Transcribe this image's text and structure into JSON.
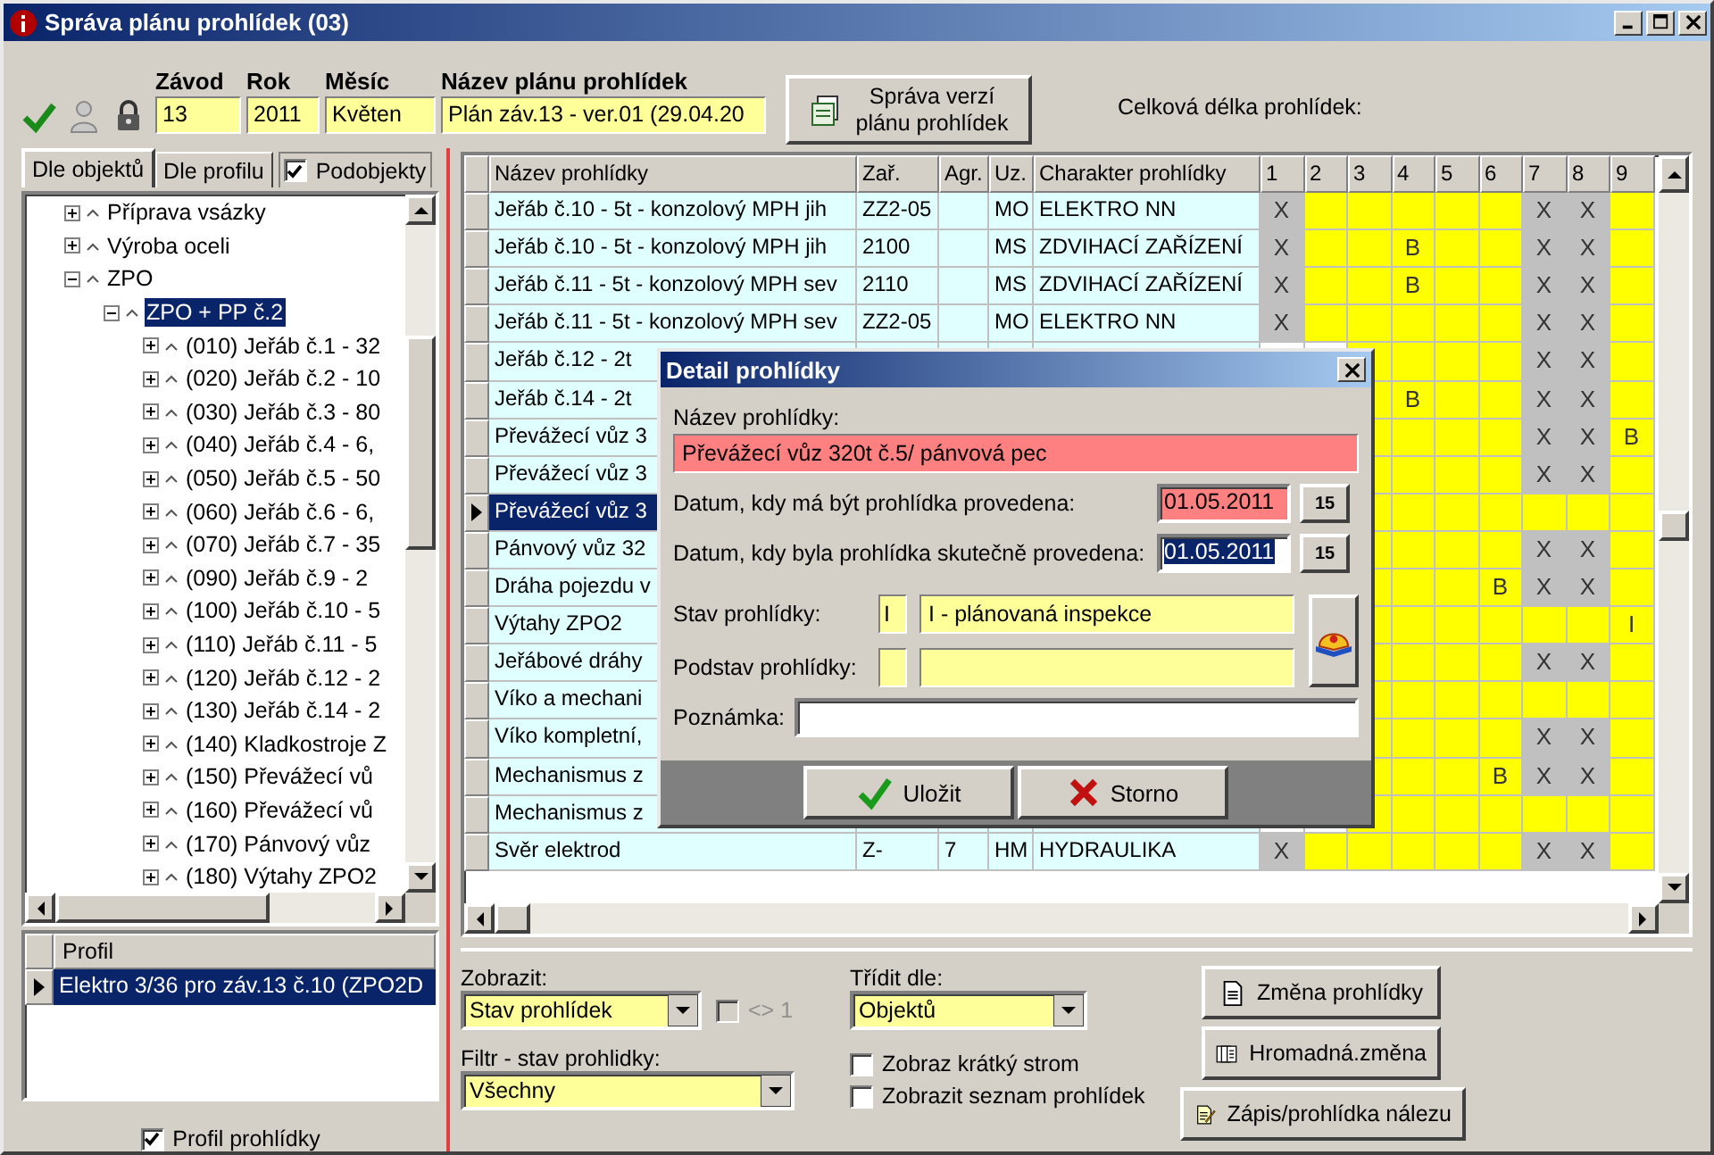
{
  "window": {
    "title": "Správa plánu prohlídek (03)"
  },
  "toolbar": {
    "fields": [
      {
        "label": "Závod",
        "value": "13"
      },
      {
        "label": "Rok",
        "value": "2011"
      },
      {
        "label": "Měsíc",
        "value": "Květen"
      },
      {
        "label": "Název plánu prohlídek",
        "value": "Plán záv.13 - ver.01 (29.04.20"
      }
    ],
    "version_button": "Správa verzí plánu prohlídek",
    "total_label": "Celková délka prohlídek:"
  },
  "left": {
    "tabs": [
      {
        "label": "Dle objektů",
        "selected": true
      },
      {
        "label": "Dle profilu",
        "selected": false
      }
    ],
    "subobjects": {
      "label": "Podobjekty",
      "checked": true
    },
    "tree": [
      {
        "label": "Příprava vsázky",
        "expanded": false,
        "selected": false
      },
      {
        "label": "Výroba oceli",
        "expanded": false,
        "selected": false
      },
      {
        "label": "ZPO",
        "expanded": true,
        "selected": false,
        "children": [
          {
            "label": "ZPO + PP č.2",
            "expanded": true,
            "selected": true,
            "children": [
              {
                "label": "(010) Jeřáb č.1 - 32",
                "expanded": false,
                "selected": false
              },
              {
                "label": "(020) Jeřáb č.2 - 10",
                "expanded": false,
                "selected": false
              },
              {
                "label": "(030) Jeřáb č.3 - 80",
                "expanded": false,
                "selected": false
              },
              {
                "label": "(040) Jeřáb č.4 - 6,",
                "expanded": false,
                "selected": false
              },
              {
                "label": "(050) Jeřáb č.5 - 50",
                "expanded": false,
                "selected": false
              },
              {
                "label": "(060) Jeřáb č.6 - 6,",
                "expanded": false,
                "selected": false
              },
              {
                "label": "(070) Jeřáb č.7 - 35",
                "expanded": false,
                "selected": false
              },
              {
                "label": "(090) Jeřáb č.9 - 2",
                "expanded": false,
                "selected": false
              },
              {
                "label": "(100) Jeřáb č.10 - 5",
                "expanded": false,
                "selected": false
              },
              {
                "label": "(110) Jeřáb č.11 - 5",
                "expanded": false,
                "selected": false
              },
              {
                "label": "(120) Jeřáb č.12 - 2",
                "expanded": false,
                "selected": false
              },
              {
                "label": "(130) Jeřáb č.14 - 2",
                "expanded": false,
                "selected": false
              },
              {
                "label": "(140) Kladkostroje Z",
                "expanded": false,
                "selected": false
              },
              {
                "label": "(150) Převážecí vů",
                "expanded": false,
                "selected": false
              },
              {
                "label": "(160) Převážecí vů",
                "expanded": false,
                "selected": false
              },
              {
                "label": "(170) Pánvový vůz",
                "expanded": false,
                "selected": false
              },
              {
                "label": "(180) Výtahy ZPO2",
                "expanded": false,
                "selected": false
              }
            ]
          }
        ]
      }
    ],
    "profile": {
      "column": "Profil",
      "rows": [
        {
          "text": "Elektro 3/36 pro záv.13 č.10 (ZPO2D",
          "selected": true
        }
      ]
    },
    "profile_check": {
      "label": "Profil prohlídky",
      "checked": true
    }
  },
  "grid": {
    "columns": [
      "Název prohlídky",
      "Zař.",
      "Agr.",
      "Uz.",
      "Charakter prohlídky",
      "1",
      "2",
      "3",
      "4",
      "5",
      "6",
      "7",
      "8",
      "9"
    ],
    "rows": [
      {
        "name": "Jeřáb č.10 - 5t - konzolový MPH jih",
        "device": "ZZ2-05",
        "uz": "MO",
        "character": "ELEKTRO NN",
        "selected": false,
        "cells": [
          {
            "kind": "blocked",
            "text": "X"
          },
          {
            "kind": "open"
          },
          {
            "kind": "open"
          },
          {
            "kind": "open"
          },
          {
            "kind": "open"
          },
          {
            "kind": "open"
          },
          {
            "kind": "blocked",
            "text": "X"
          },
          {
            "kind": "blocked",
            "text": "X"
          },
          {
            "kind": "open"
          }
        ]
      },
      {
        "name": "Jeřáb č.10 - 5t - konzolový MPH jih",
        "device": "2100",
        "uz": "MS",
        "character": "ZDVIHACÍ ZAŘÍZENÍ",
        "selected": false,
        "cells": [
          {
            "kind": "blocked",
            "text": "X"
          },
          {
            "kind": "open"
          },
          {
            "kind": "open"
          },
          {
            "kind": "open",
            "text": "B"
          },
          {
            "kind": "open"
          },
          {
            "kind": "open"
          },
          {
            "kind": "blocked",
            "text": "X"
          },
          {
            "kind": "blocked",
            "text": "X"
          },
          {
            "kind": "open"
          }
        ]
      },
      {
        "name": "Jeřáb č.11 - 5t - konzolový MPH sev",
        "device": "2110",
        "uz": "MS",
        "character": "ZDVIHACÍ ZAŘÍZENÍ",
        "selected": false,
        "cells": [
          {
            "kind": "blocked",
            "text": "X"
          },
          {
            "kind": "open"
          },
          {
            "kind": "open"
          },
          {
            "kind": "open",
            "text": "B"
          },
          {
            "kind": "open"
          },
          {
            "kind": "open"
          },
          {
            "kind": "blocked",
            "text": "X"
          },
          {
            "kind": "blocked",
            "text": "X"
          },
          {
            "kind": "open"
          }
        ]
      },
      {
        "name": "Jeřáb č.11 - 5t - konzolový MPH sev",
        "device": "ZZ2-05",
        "uz": "MO",
        "character": "ELEKTRO NN",
        "selected": false,
        "cells": [
          {
            "kind": "blocked",
            "text": "X"
          },
          {
            "kind": "open"
          },
          {
            "kind": "open"
          },
          {
            "kind": "open"
          },
          {
            "kind": "open"
          },
          {
            "kind": "open"
          },
          {
            "kind": "blocked",
            "text": "X"
          },
          {
            "kind": "blocked",
            "text": "X"
          },
          {
            "kind": "open"
          }
        ]
      },
      {
        "name": "Jeřáb č.12 - 2t",
        "selected": false,
        "cells": [
          {},
          {},
          {
            "kind": "open"
          },
          {
            "kind": "open"
          },
          {
            "kind": "open"
          },
          {
            "kind": "open"
          },
          {
            "kind": "blocked",
            "text": "X"
          },
          {
            "kind": "blocked",
            "text": "X"
          },
          {
            "kind": "open"
          }
        ]
      },
      {
        "name": "Jeřáb č.14 - 2t",
        "selected": false,
        "cells": [
          {},
          {},
          {
            "kind": "open"
          },
          {
            "kind": "open",
            "text": "B"
          },
          {
            "kind": "open"
          },
          {
            "kind": "open"
          },
          {
            "kind": "blocked",
            "text": "X"
          },
          {
            "kind": "blocked",
            "text": "X"
          },
          {
            "kind": "open"
          }
        ]
      },
      {
        "name": "Převážecí vůz 3",
        "selected": false,
        "cells": [
          {},
          {},
          {
            "kind": "open"
          },
          {
            "kind": "open"
          },
          {
            "kind": "open"
          },
          {
            "kind": "open"
          },
          {
            "kind": "blocked",
            "text": "X"
          },
          {
            "kind": "blocked",
            "text": "X"
          },
          {
            "kind": "open",
            "text": "B"
          }
        ]
      },
      {
        "name": "Převážecí vůz 3",
        "selected": false,
        "cells": [
          {},
          {},
          {
            "kind": "open"
          },
          {
            "kind": "open"
          },
          {
            "kind": "open"
          },
          {
            "kind": "open"
          },
          {
            "kind": "blocked",
            "text": "X"
          },
          {
            "kind": "blocked",
            "text": "X"
          },
          {
            "kind": "open"
          }
        ]
      },
      {
        "name": "Převážecí vůz 3",
        "selected": true,
        "cells": [
          {},
          {},
          {
            "kind": "open"
          },
          {
            "kind": "open"
          },
          {
            "kind": "open"
          },
          {
            "kind": "open"
          },
          {
            "kind": "open"
          },
          {
            "kind": "open"
          },
          {
            "kind": "open"
          }
        ]
      },
      {
        "name": "Pánvový vůz 32",
        "selected": false,
        "cells": [
          {},
          {},
          {
            "kind": "open"
          },
          {
            "kind": "open"
          },
          {
            "kind": "open"
          },
          {
            "kind": "open"
          },
          {
            "kind": "blocked",
            "text": "X"
          },
          {
            "kind": "blocked",
            "text": "X"
          },
          {
            "kind": "open"
          }
        ]
      },
      {
        "name": "Dráha pojezdu v",
        "selected": false,
        "cells": [
          {},
          {},
          {
            "kind": "open"
          },
          {
            "kind": "open"
          },
          {
            "kind": "open"
          },
          {
            "kind": "open",
            "text": "B"
          },
          {
            "kind": "blocked",
            "text": "X"
          },
          {
            "kind": "blocked",
            "text": "X"
          },
          {
            "kind": "open"
          }
        ]
      },
      {
        "name": "Výtahy ZPO2",
        "selected": false,
        "cells": [
          {},
          {},
          {
            "kind": "open"
          },
          {
            "kind": "open"
          },
          {
            "kind": "open"
          },
          {
            "kind": "open"
          },
          {
            "kind": "open"
          },
          {
            "kind": "open"
          },
          {
            "kind": "open",
            "text": "I"
          }
        ]
      },
      {
        "name": "Jeřábové dráhy",
        "selected": false,
        "cells": [
          {},
          {},
          {
            "kind": "open"
          },
          {
            "kind": "open"
          },
          {
            "kind": "open"
          },
          {
            "kind": "open"
          },
          {
            "kind": "blocked",
            "text": "X"
          },
          {
            "kind": "blocked",
            "text": "X"
          },
          {
            "kind": "open"
          }
        ]
      },
      {
        "name": "Víko a mechani",
        "selected": false,
        "cells": [
          {},
          {},
          {
            "kind": "open"
          },
          {
            "kind": "open"
          },
          {
            "kind": "open"
          },
          {
            "kind": "open"
          },
          {
            "kind": "open"
          },
          {
            "kind": "open"
          },
          {
            "kind": "open"
          }
        ]
      },
      {
        "name": "Víko kompletní,",
        "selected": false,
        "cells": [
          {},
          {},
          {
            "kind": "open"
          },
          {
            "kind": "open"
          },
          {
            "kind": "open"
          },
          {
            "kind": "open"
          },
          {
            "kind": "blocked",
            "text": "X"
          },
          {
            "kind": "blocked",
            "text": "X"
          },
          {
            "kind": "open"
          }
        ]
      },
      {
        "name": "Mechanismus z",
        "selected": false,
        "cells": [
          {},
          {},
          {
            "kind": "open"
          },
          {
            "kind": "open"
          },
          {
            "kind": "open"
          },
          {
            "kind": "open",
            "text": "B"
          },
          {
            "kind": "blocked",
            "text": "X"
          },
          {
            "kind": "blocked",
            "text": "X"
          },
          {
            "kind": "open"
          }
        ]
      },
      {
        "name": "Mechanismus z",
        "selected": false,
        "cells": [
          {},
          {},
          {
            "kind": "open"
          },
          {
            "kind": "open"
          },
          {
            "kind": "open"
          },
          {
            "kind": "open"
          },
          {
            "kind": "open"
          },
          {
            "kind": "open"
          },
          {
            "kind": "open"
          }
        ]
      },
      {
        "name": "Svěr elektrod",
        "device": "Z-",
        "agr": "7",
        "uz": "HM",
        "character": "HYDRAULIKA",
        "selected": false,
        "cells": [
          {
            "kind": "blocked",
            "text": "X"
          },
          {
            "kind": "open"
          },
          {
            "kind": "open"
          },
          {
            "kind": "open"
          },
          {
            "kind": "open"
          },
          {
            "kind": "open"
          },
          {
            "kind": "blocked",
            "text": "X"
          },
          {
            "kind": "blocked",
            "text": "X"
          },
          {
            "kind": "open"
          }
        ]
      }
    ]
  },
  "dialog": {
    "title": "Detail prohlídky",
    "name_label": "Název prohlídky:",
    "name_value": "Převážecí vůz 320t č.5/ pánvová pec",
    "name_required": true,
    "dates": [
      {
        "label": "Datum, kdy má být prohlídka provedena:",
        "value": "01.05.2011",
        "required": true,
        "focused": false,
        "button": "15"
      },
      {
        "label": "Datum, kdy byla prohlídka skutečně provedena:",
        "value": "01.05.2011",
        "required": false,
        "focused": true,
        "button": "15"
      }
    ],
    "states": [
      {
        "label": "Stav prohlídky:",
        "code": "I",
        "value": "I - plánovaná inspekce"
      },
      {
        "label": "Podstav prohlídky:"
      }
    ],
    "note_label": "Poznámka:",
    "buttons": [
      {
        "label": "Uložit",
        "kind": "save"
      },
      {
        "label": "Storno",
        "kind": "cancel"
      }
    ]
  },
  "bottom": {
    "show_label": "Zobrazit:",
    "show_value": "Stav prohlídek",
    "not_one": {
      "label": "<> 1",
      "checked": false,
      "disabled": true
    },
    "filter_label": "Filtr - stav prohlidky:",
    "filter_value": "Všechny",
    "sort_label": "Třídit dle:",
    "sort_value": "Objektů",
    "options": [
      {
        "label": "Zobraz krátký strom",
        "checked": false
      },
      {
        "label": "Zobrazit seznam prohlídek",
        "checked": false
      }
    ],
    "actions": [
      {
        "label": "Změna prohlídky",
        "kind": "doc"
      },
      {
        "label": "Hromadná.změna",
        "kind": "docs"
      },
      {
        "label": "Zápis/prohlídka nálezu",
        "kind": "edit"
      }
    ]
  }
}
